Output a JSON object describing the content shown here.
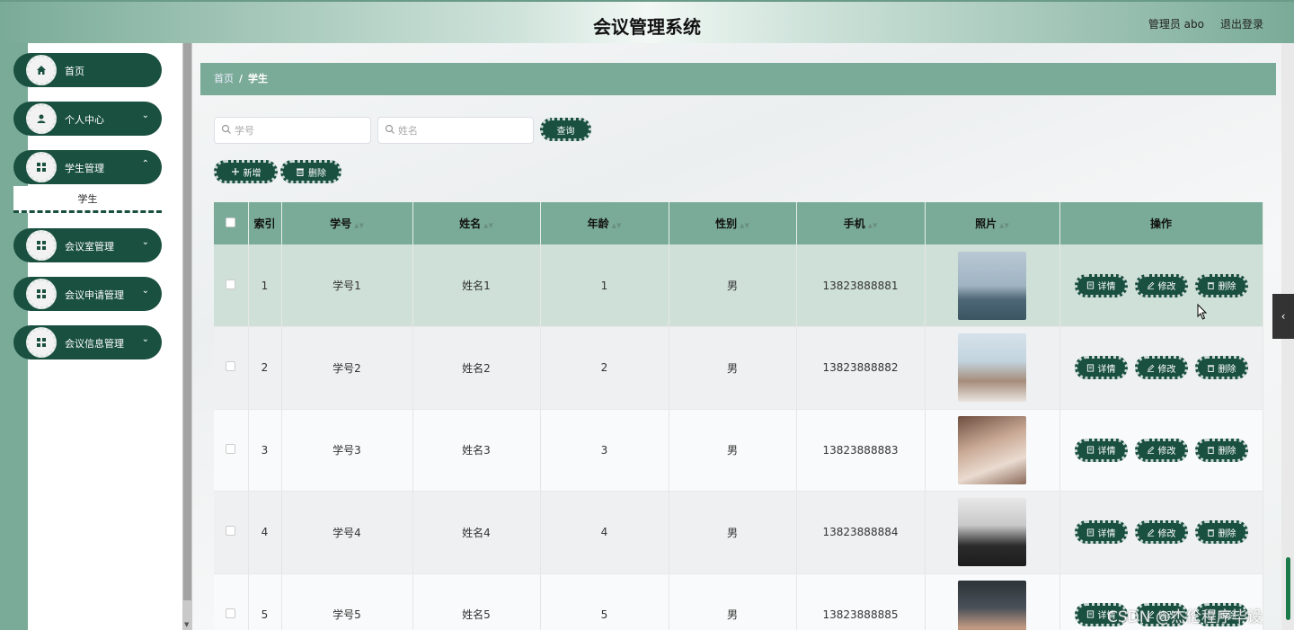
{
  "header": {
    "title": "会议管理系统",
    "user": "管理员 abo",
    "logout": "退出登录"
  },
  "sidebar": {
    "items": [
      {
        "label": "首页",
        "icon": "home-icon",
        "has_chevron": false
      },
      {
        "label": "个人中心",
        "icon": "user-icon",
        "has_chevron": true
      },
      {
        "label": "学生管理",
        "icon": "grid-icon",
        "has_chevron": true,
        "expanded": true
      },
      {
        "label": "会议室管理",
        "icon": "grid-icon",
        "has_chevron": true
      },
      {
        "label": "会议申请管理",
        "icon": "grid-icon",
        "has_chevron": true
      },
      {
        "label": "会议信息管理",
        "icon": "grid-icon",
        "has_chevron": true
      }
    ],
    "submenu": {
      "label": "学生"
    }
  },
  "breadcrumb": {
    "home": "首页",
    "separator": "/",
    "current": "学生"
  },
  "search": {
    "student_no_placeholder": "学号",
    "name_placeholder": "姓名",
    "query_button": "查询"
  },
  "actions": {
    "add": "新增",
    "delete": "删除"
  },
  "table": {
    "columns": [
      "索引",
      "学号",
      "姓名",
      "年龄",
      "性别",
      "手机",
      "照片",
      "操作"
    ],
    "rows": [
      {
        "index": "1",
        "student_no": "学号1",
        "name": "姓名1",
        "age": "1",
        "gender": "男",
        "phone": "13823888881"
      },
      {
        "index": "2",
        "student_no": "学号2",
        "name": "姓名2",
        "age": "2",
        "gender": "男",
        "phone": "13823888882"
      },
      {
        "index": "3",
        "student_no": "学号3",
        "name": "姓名3",
        "age": "3",
        "gender": "男",
        "phone": "13823888883"
      },
      {
        "index": "4",
        "student_no": "学号4",
        "name": "姓名4",
        "age": "4",
        "gender": "男",
        "phone": "13823888884"
      },
      {
        "index": "5",
        "student_no": "学号5",
        "name": "姓名5",
        "age": "5",
        "gender": "男",
        "phone": "13823888885"
      }
    ],
    "ops": {
      "detail": "详情",
      "edit": "修改",
      "delete": "删除"
    }
  },
  "watermark": "CSDN @杰伦程序毕设",
  "colors": {
    "primary": "#1a5040",
    "accent": "#7aab98"
  }
}
